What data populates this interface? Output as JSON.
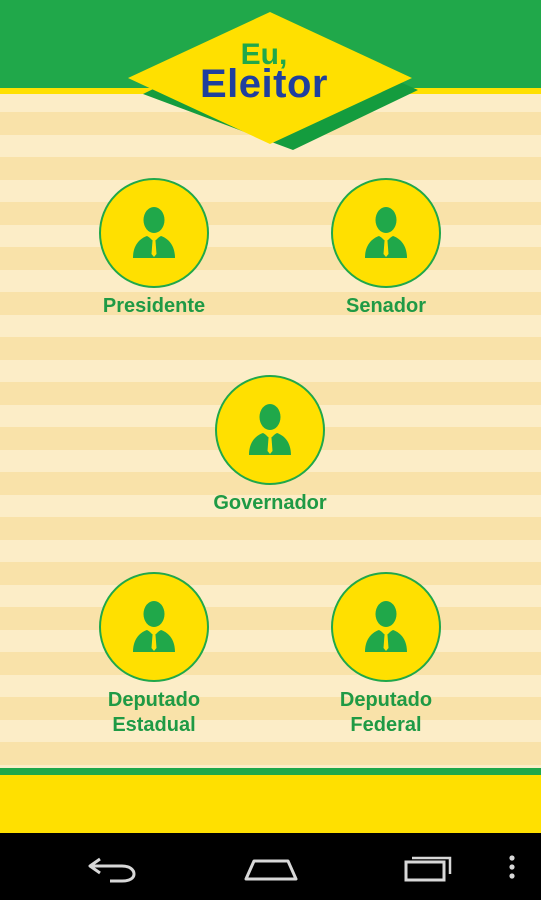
{
  "app": {
    "logo_line1": "Eu,",
    "logo_line2": "Eleitor"
  },
  "roles": [
    {
      "id": "presidente",
      "label": "Presidente"
    },
    {
      "id": "senador",
      "label": "Senador"
    },
    {
      "id": "governador",
      "label": "Governador"
    },
    {
      "id": "deputado-estadual",
      "label_line1": "Deputado",
      "label_line2": "Estadual"
    },
    {
      "id": "deputado-federal",
      "label_line1": "Deputado",
      "label_line2": "Federal"
    }
  ],
  "icons": {
    "role_icon": "politician-icon",
    "nav_back": "back-icon",
    "nav_home": "home-icon",
    "nav_recents": "recent-apps-icon",
    "nav_menu": "overflow-menu-icon"
  },
  "colors": {
    "brand_green": "#20a84a",
    "brand_yellow": "#ffe000",
    "brand_blue": "#1f3f9e",
    "stripe_light": "#fcedc7",
    "stripe_dark": "#f9e2a9"
  }
}
